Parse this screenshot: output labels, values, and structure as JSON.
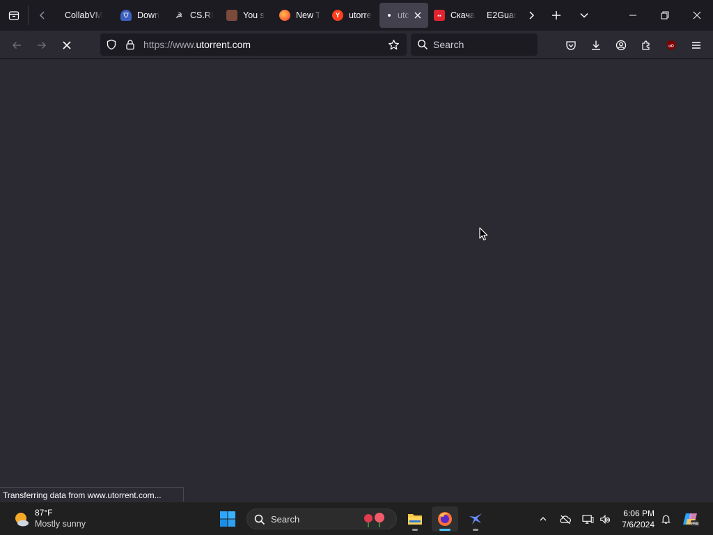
{
  "browser": {
    "tabs": [
      {
        "label": "CollabVM",
        "favicon": "collabvm-icon"
      },
      {
        "label": "Down",
        "favicon": "shield-favicon-icon"
      },
      {
        "label": "CS.RI",
        "favicon": "cs-favicon-icon"
      },
      {
        "label": "You s",
        "favicon": "avatar-favicon-icon"
      },
      {
        "label": "New T",
        "favicon": "firefox-icon"
      },
      {
        "label": "utorre",
        "favicon": "yandex-icon"
      },
      {
        "label": "utc",
        "favicon": "loading-dot-icon",
        "active": true
      },
      {
        "label": "Скача",
        "favicon": "red-site-icon"
      },
      {
        "label": "E2Guar",
        "favicon": "none"
      }
    ],
    "url_protocol": "https://www.",
    "url_domain": "utorrent.com",
    "search_placeholder": "Search",
    "status_text": "Transferring data from www.utorrent.com..."
  },
  "taskbar": {
    "weather_temp": "87°F",
    "weather_condition": "Mostly sunny",
    "search_placeholder": "Search",
    "time": "6:06 PM",
    "date": "7/6/2024"
  },
  "colors": {
    "toolbar": "#2b2a33",
    "tabstrip": "#1c1b22",
    "accent_firefox": "#ff7139",
    "taskbar": "#202020",
    "taskbar_active_indicator": "#4cc2ff"
  }
}
